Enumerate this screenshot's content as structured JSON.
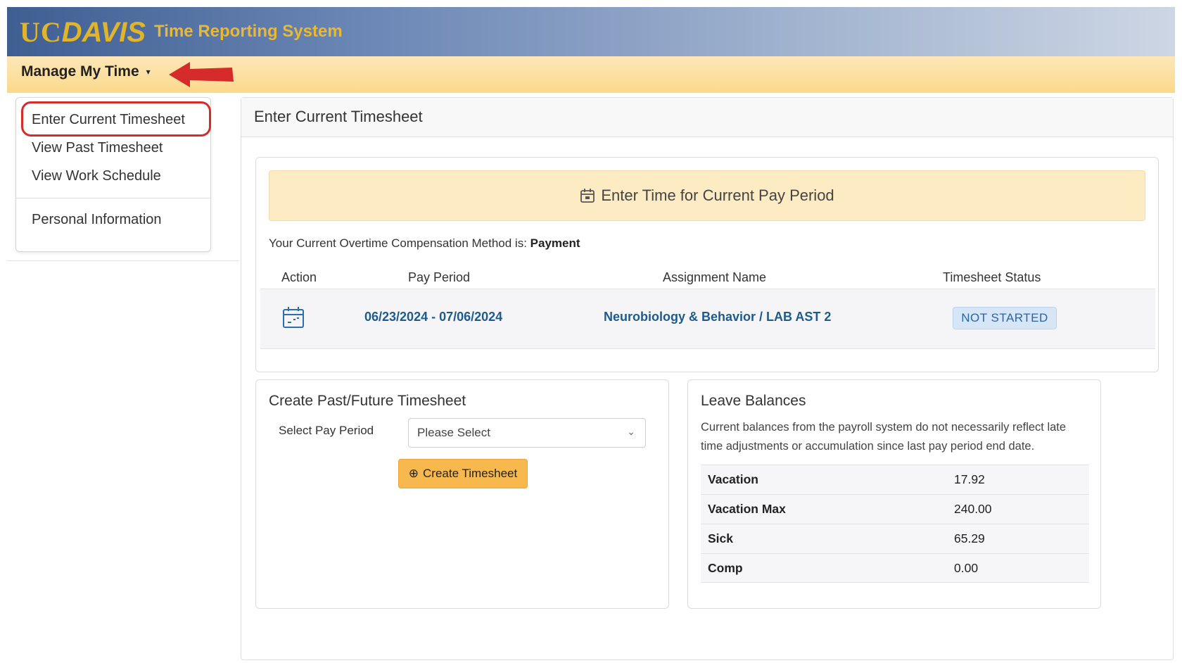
{
  "header": {
    "logo_uc": "UC",
    "logo_davis": "DAVIS",
    "app_title": "Time Reporting System"
  },
  "menubar": {
    "menu_label": "Manage My Time"
  },
  "dropdown": {
    "items": [
      {
        "label": "Enter Current Timesheet"
      },
      {
        "label": "View Past Timesheet"
      },
      {
        "label": "View Work Schedule"
      },
      {
        "label": "Personal Information"
      }
    ]
  },
  "main": {
    "title": "Enter Current Timesheet",
    "banner": "Enter Time for Current Pay Period",
    "overtime_prefix": "Your Current Overtime Compensation Method is:",
    "overtime_value": "Payment",
    "table": {
      "headers": [
        "Action",
        "Pay Period",
        "Assignment Name",
        "Timesheet Status"
      ],
      "row": {
        "pay_period": "06/23/2024 - 07/06/2024",
        "assignment": "Neurobiology & Behavior / LAB AST 2",
        "status": "NOT STARTED"
      }
    }
  },
  "past_future": {
    "title": "Create Past/Future Timesheet",
    "field_label": "Select Pay Period",
    "select_value": "Please Select",
    "button_label": "Create Timesheet"
  },
  "leave": {
    "title": "Leave Balances",
    "description": "Current balances from the payroll system do not necessarily reflect late time adjustments or accumulation since last pay period end date.",
    "rows": [
      {
        "name": "Vacation",
        "value": "17.92"
      },
      {
        "name": "Vacation Max",
        "value": "240.00"
      },
      {
        "name": "Sick",
        "value": "65.29"
      },
      {
        "name": "Comp",
        "value": "0.00"
      }
    ]
  },
  "colors": {
    "accent_gold": "#e8b931",
    "annotation_red": "#d62b2b",
    "link_blue": "#1e5b8c",
    "button_orange": "#f7b84e"
  }
}
